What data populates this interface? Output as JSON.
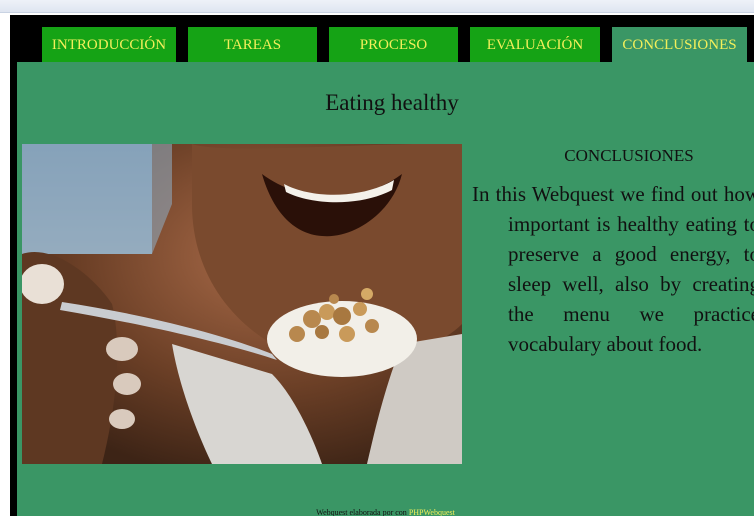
{
  "nav": {
    "tabs": [
      {
        "label": "INTRODUCCIÓN"
      },
      {
        "label": "TAREAS"
      },
      {
        "label": "PROCESO"
      },
      {
        "label": "EVALUACIÓN"
      },
      {
        "label": "CONCLUSIONES"
      }
    ],
    "active_tab": "CONCLUSIONES"
  },
  "page": {
    "title": "Eating healthy"
  },
  "photo": {
    "subject": "smiling person holding spoon of yogurt with granola"
  },
  "section": {
    "heading": "CONCLUSIONES",
    "body": "In this Webquest we find out how important is healthy eating to preserve a good energy, to sleep well, also by creating the menu we practice vocabulary about food."
  },
  "footer": {
    "text": "Webquest elaborada por con",
    "link_label": "PHPWebquest"
  },
  "colors": {
    "content_bg": "#3a9665",
    "tab_bg": "#15a315",
    "tab_text": "#f2ef5a",
    "frame": "#000000"
  }
}
